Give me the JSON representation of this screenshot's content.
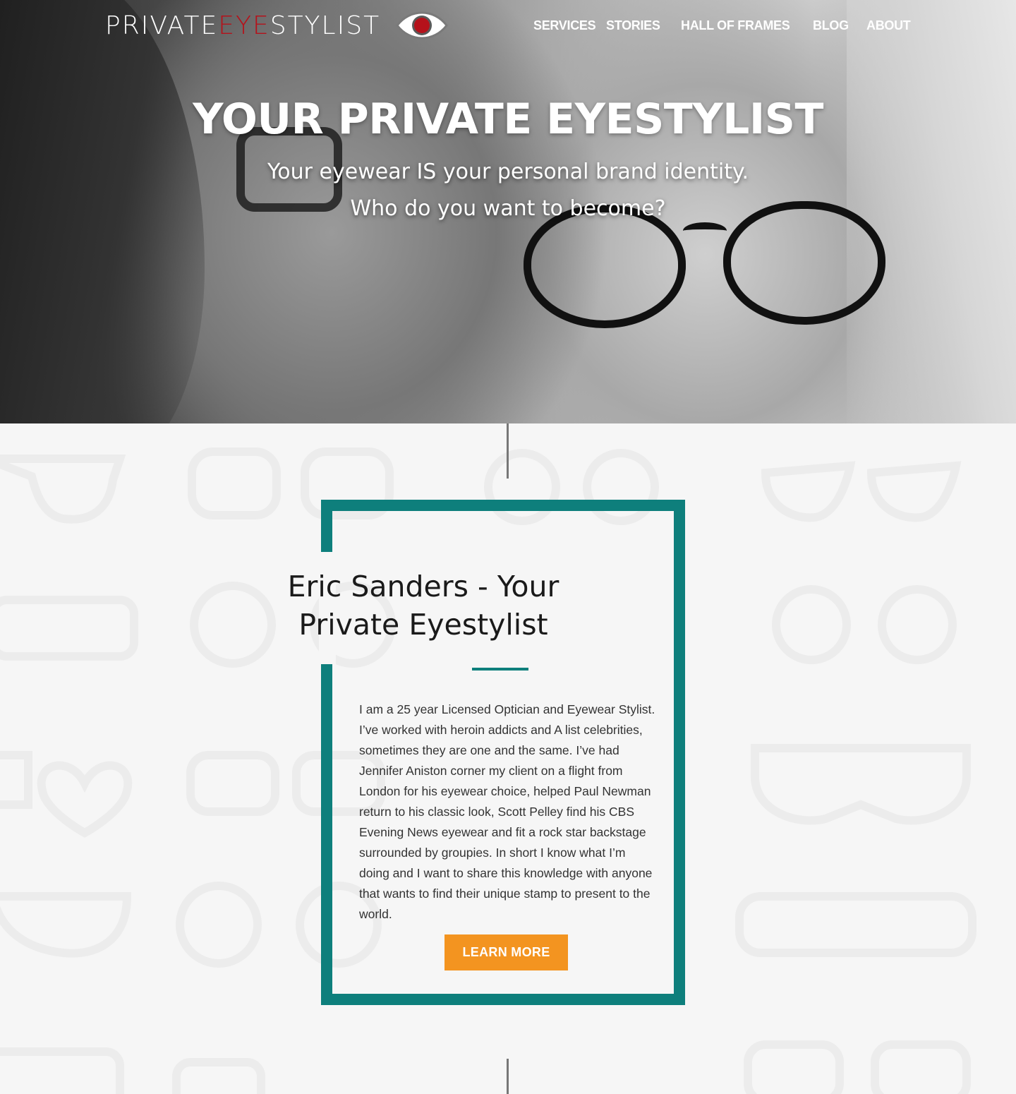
{
  "logo": {
    "part1": "PRIVATE ",
    "part2": "EYE",
    "part3": "STYLIST",
    "accent_color": "#b5121b",
    "icon": "eye-icon"
  },
  "nav": {
    "items": [
      {
        "label": "SERVICES"
      },
      {
        "label": "STORIES"
      },
      {
        "label": "HALL OF FRAMES"
      },
      {
        "label": "BLOG"
      },
      {
        "label": "ABOUT"
      }
    ]
  },
  "hero": {
    "title": "YOUR PRIVATE EYESTYLIST",
    "subtitle_line1": "Your eyewear IS your personal brand identity.",
    "subtitle_line2": "Who do you want to become?"
  },
  "about": {
    "title": "Eric Sanders - Your Private Eyestylist",
    "body": "I am a 25 year Licensed Optician and Eyewear Stylist. I’ve worked with heroin addicts and A list celebrities, sometimes they are one and the same. I’ve had Jennifer Aniston corner my client on a flight from London for his eyewear choice, helped Paul Newman return to his classic look, Scott Pelley find his CBS Evening News eyewear and fit a rock star backstage surrounded by groupies. In short I know what I’m doing and I want to share this knowledge with anyone that wants to find their unique stamp to present to the world.",
    "button_label": "LEARN MORE",
    "frame_color": "#0e7f7c",
    "button_color": "#f39420"
  }
}
